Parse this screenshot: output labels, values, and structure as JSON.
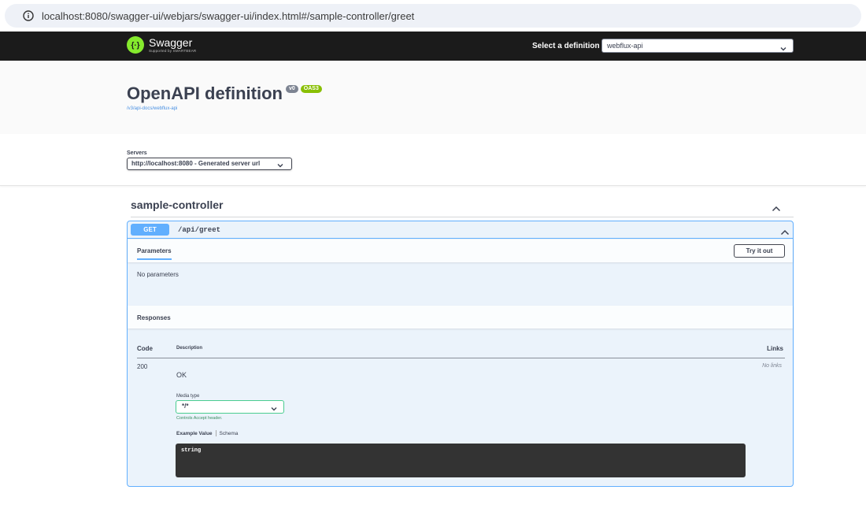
{
  "browser": {
    "url": "localhost:8080/swagger-ui/webjars/swagger-ui/index.html#/sample-controller/greet"
  },
  "topbar": {
    "logo_text": "Swagger",
    "logo_subtext": "Supported by SMARTBEAR",
    "definition_label": "Select a definition",
    "definition_value": "webflux-api"
  },
  "info": {
    "title": "OpenAPI definition",
    "version_badge": "v0",
    "oas_badge": "OAS3",
    "spec_link": "/v3/api-docs/webflux-api"
  },
  "servers": {
    "label": "Servers",
    "selected": "http://localhost:8080 - Generated server url"
  },
  "tag": {
    "name": "sample-controller"
  },
  "operation": {
    "method": "GET",
    "path": "/api/greet",
    "parameters_tab": "Parameters",
    "try_it_out": "Try it out",
    "no_parameters": "No parameters",
    "responses_title": "Responses",
    "columns": {
      "code": "Code",
      "description": "Description",
      "links": "Links"
    },
    "response": {
      "code": "200",
      "description": "OK",
      "links": "No links",
      "media_type_label": "Media type",
      "media_type": "*/*",
      "controls_note": "Controls Accept header.",
      "example_tab": "Example Value",
      "schema_tab": "Schema",
      "example_code": "string"
    }
  },
  "colors": {
    "topbar": "#1b1b1b",
    "get_accent": "#61affe",
    "get_bg": "#ebf3fb",
    "logo_green": "#85ea2d",
    "oas_green": "#89bf04",
    "media_border": "#49cc90"
  },
  "icons": {
    "info": "info-icon",
    "swagger_logo": "swagger-logo-icon",
    "chevron_down": "chevron-down-icon",
    "chevron_up": "chevron-up-icon"
  }
}
